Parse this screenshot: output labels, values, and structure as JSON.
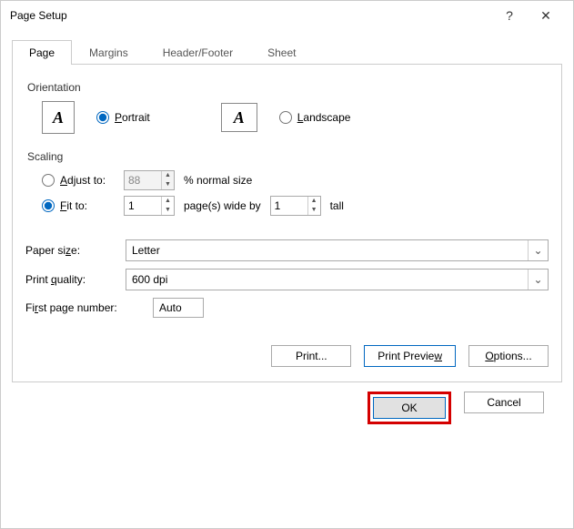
{
  "title": "Page Setup",
  "helpGlyph": "?",
  "closeGlyph": "✕",
  "tabs": {
    "page": "Page",
    "margins": "Margins",
    "headerFooter": "Header/Footer",
    "sheet": "Sheet"
  },
  "orientation": {
    "label": "Orientation",
    "portrait": "Portrait",
    "landscape": "Landscape",
    "glyph": "A"
  },
  "scaling": {
    "label": "Scaling",
    "adjustTo": "Adjust to:",
    "adjustValue": "88",
    "adjustSuffix": "% normal size",
    "fitTo": "Fit to:",
    "fitWide": "1",
    "fitMiddle": "page(s) wide by",
    "fitTall": "1",
    "fitSuffix": "tall"
  },
  "paperSize": {
    "label": "Paper size:",
    "value": "Letter"
  },
  "printQuality": {
    "label": "Print quality:",
    "value": "600 dpi"
  },
  "firstPage": {
    "label": "First page number:",
    "value": "Auto"
  },
  "actions": {
    "print": "Print...",
    "preview": "Print Preview",
    "options": "Options..."
  },
  "footer": {
    "ok": "OK",
    "cancel": "Cancel"
  }
}
